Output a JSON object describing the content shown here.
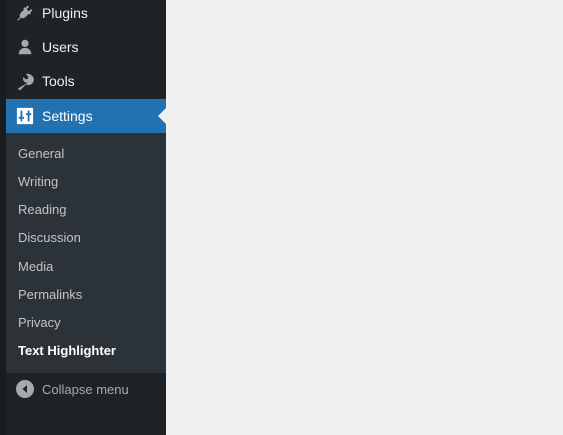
{
  "colors": {
    "sidebar_bg": "#1d2327",
    "submenu_bg": "#2c3338",
    "accent": "#2271b1",
    "content_bg": "#f0f0f1"
  },
  "menu": {
    "items": [
      {
        "label": "Plugins",
        "icon": "plugins-icon"
      },
      {
        "label": "Users",
        "icon": "users-icon"
      },
      {
        "label": "Tools",
        "icon": "tools-icon"
      },
      {
        "label": "Settings",
        "icon": "settings-icon",
        "current": true
      }
    ]
  },
  "submenu": {
    "items": [
      {
        "label": "General"
      },
      {
        "label": "Writing"
      },
      {
        "label": "Reading"
      },
      {
        "label": "Discussion"
      },
      {
        "label": "Media"
      },
      {
        "label": "Permalinks"
      },
      {
        "label": "Privacy"
      },
      {
        "label": "Text Highlighter",
        "current": true
      }
    ]
  },
  "collapse": {
    "label": "Collapse menu",
    "icon": "collapse-icon"
  }
}
